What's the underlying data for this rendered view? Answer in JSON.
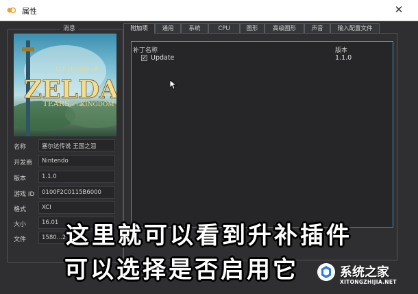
{
  "window": {
    "title": "属性",
    "close_glyph": "✕"
  },
  "info": {
    "legend": "消息",
    "cover_lines": [
      "THE LEGEND OF",
      "ZELDA",
      "TEARS",
      "OF THE",
      "KINGDOM"
    ],
    "fields": [
      {
        "label": "名称",
        "value": "塞尔达传说 王国之泪"
      },
      {
        "label": "开发商",
        "value": "Nintendo"
      },
      {
        "label": "版本",
        "value": "1.1.0"
      },
      {
        "label": "游戏 ID",
        "value": "0100F2C0115B6000"
      },
      {
        "label": "格式",
        "value": "XCI"
      },
      {
        "label": "大小",
        "value": "16.01"
      },
      {
        "label": "文件",
        "value": "1580...2"
      }
    ]
  },
  "tabs": [
    "附加项",
    "通用",
    "系统",
    "CPU",
    "图形",
    "高级图形",
    "声音",
    "输入配置文件"
  ],
  "addons": {
    "col_name": "补丁名称",
    "col_version": "版本",
    "rows": [
      {
        "name": "Update",
        "version": "1.1.0",
        "checked": true
      }
    ]
  },
  "caption": {
    "line1": "这里就可以看到升补插件",
    "line2": "可以选择是否启用它"
  },
  "watermark": {
    "cn": "系统之家",
    "en": "XITONGZHIJIA.NET"
  }
}
